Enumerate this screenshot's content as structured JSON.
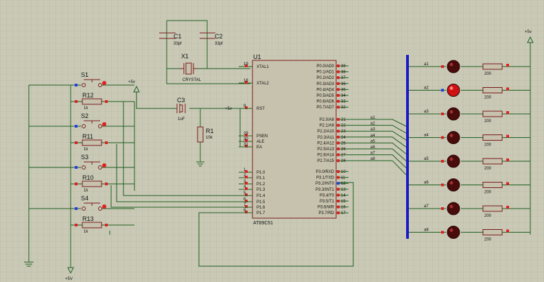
{
  "colors": {
    "background": "#c9c9b6",
    "grid": "#b4b4a2",
    "wire": "#1f5f1f",
    "body": "#7a1b1b",
    "chip_fill": "#c6c2ad",
    "bus": "#1818c8",
    "pin_red": "#e02020",
    "pin_blue": "#2040e0",
    "led_off": "#4a0b0b",
    "led_on": "#d01010"
  },
  "chip": {
    "ref": "U1",
    "part": "AT89C51",
    "left_pins": [
      {
        "num": "19",
        "name": "XTAL1"
      },
      {
        "num": "18",
        "name": "XTAL2"
      },
      {
        "num": "9",
        "name": "RST"
      },
      {
        "num": "29",
        "name": "PSEN"
      },
      {
        "num": "30",
        "name": "ALE"
      },
      {
        "num": "31",
        "name": "EA"
      },
      {
        "num": "1",
        "name": "P1.0"
      },
      {
        "num": "2",
        "name": "P1.1"
      },
      {
        "num": "3",
        "name": "P1.2"
      },
      {
        "num": "4",
        "name": "P1.3"
      },
      {
        "num": "5",
        "name": "P1.4"
      },
      {
        "num": "6",
        "name": "P1.5"
      },
      {
        "num": "7",
        "name": "P1.6"
      },
      {
        "num": "8",
        "name": "P1.7"
      }
    ],
    "right_pins": [
      {
        "num": "39",
        "name": "P0.0/AD0"
      },
      {
        "num": "38",
        "name": "P0.1/AD1"
      },
      {
        "num": "37",
        "name": "P0.2/AD2"
      },
      {
        "num": "36",
        "name": "P0.3/AD3"
      },
      {
        "num": "35",
        "name": "P0.4/AD4"
      },
      {
        "num": "34",
        "name": "P0.5/AD5"
      },
      {
        "num": "33",
        "name": "P0.6/AD6"
      },
      {
        "num": "32",
        "name": "P0.7/AD7"
      },
      {
        "num": "21",
        "name": "P2.0/A8"
      },
      {
        "num": "22",
        "name": "P2.1/A9"
      },
      {
        "num": "23",
        "name": "P2.2/A10"
      },
      {
        "num": "24",
        "name": "P2.3/A11"
      },
      {
        "num": "25",
        "name": "P2.4/A12"
      },
      {
        "num": "26",
        "name": "P2.5/A13"
      },
      {
        "num": "27",
        "name": "P2.6/A14"
      },
      {
        "num": "28",
        "name": "P2.7/A15"
      },
      {
        "num": "10",
        "name": "P3.0/RXD"
      },
      {
        "num": "11",
        "name": "P3.1/TXD"
      },
      {
        "num": "12",
        "name": "P3.2/INT0"
      },
      {
        "num": "13",
        "name": "P3.3/INT1"
      },
      {
        "num": "14",
        "name": "P3.4/T0"
      },
      {
        "num": "15",
        "name": "P3.5/T1"
      },
      {
        "num": "16",
        "name": "P3.6/WR"
      },
      {
        "num": "17",
        "name": "P3.7/RD"
      }
    ]
  },
  "bus_labels": [
    "a1",
    "a2",
    "a3",
    "a4",
    "a5",
    "a6",
    "a7",
    "a8"
  ],
  "crystal": {
    "ref": "X1",
    "value": "CRYSTAL"
  },
  "caps": [
    {
      "ref": "C1",
      "value": "33pf"
    },
    {
      "ref": "C2",
      "value": "33pf"
    },
    {
      "ref": "C3",
      "value": "1uF"
    }
  ],
  "reset_resistor": {
    "ref": "R1",
    "value": "10k"
  },
  "switches": [
    {
      "ref": "S1",
      "res_ref": "R12",
      "res_value": "1k"
    },
    {
      "ref": "S2",
      "res_ref": "R11",
      "res_value": "1k"
    },
    {
      "ref": "S3",
      "res_ref": "R10",
      "res_value": "1k"
    },
    {
      "ref": "S4",
      "res_ref": "R13",
      "res_value": "1k"
    }
  ],
  "leds": [
    {
      "label": "a1",
      "res_value": "200",
      "lit": false
    },
    {
      "label": "a2",
      "res_value": "200",
      "lit": true
    },
    {
      "label": "a3",
      "res_value": "200",
      "lit": false
    },
    {
      "label": "a4",
      "res_value": "200",
      "lit": false
    },
    {
      "label": "a5",
      "res_value": "200",
      "lit": false
    },
    {
      "label": "a6",
      "res_value": "200",
      "lit": false
    },
    {
      "label": "a7",
      "res_value": "200",
      "lit": false
    },
    {
      "label": "a8",
      "res_value": "200",
      "lit": false
    }
  ],
  "power_labels": {
    "vcc": "+5v",
    "vcc_bottom": "+5V"
  }
}
